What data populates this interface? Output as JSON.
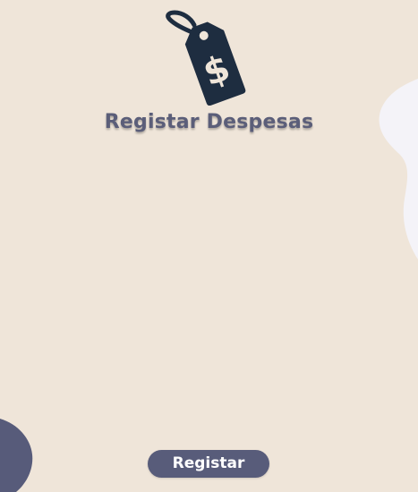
{
  "header": {
    "icon": "price-tag-dollar-icon",
    "title": "Registar Despesas"
  },
  "actions": {
    "register_label": "Registar"
  },
  "colors": {
    "background": "#efe5d9",
    "accent": "#585c7a",
    "icon": "#1e2d40",
    "blob_light": "#f4f3f8",
    "blob_dark": "#575b7a"
  }
}
